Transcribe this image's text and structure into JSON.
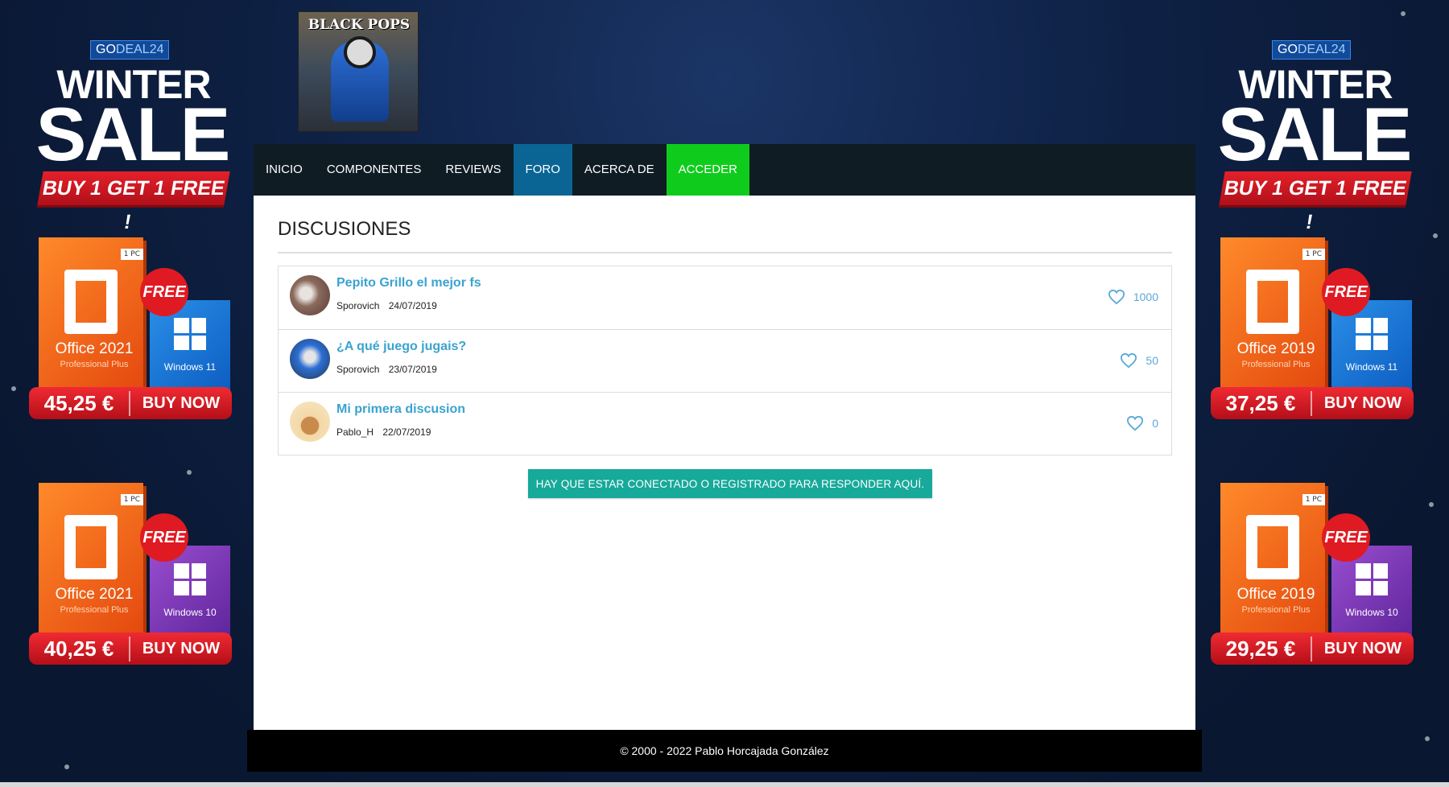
{
  "site": {
    "logo_text": "BLACK POPS"
  },
  "nav": {
    "items": [
      {
        "label": "INICIO"
      },
      {
        "label": "COMPONENTES"
      },
      {
        "label": "REVIEWS"
      },
      {
        "label": "FORO"
      },
      {
        "label": "ACERCA DE"
      },
      {
        "label": "ACCEDER"
      }
    ],
    "active": "FORO",
    "active_color": "#0a6594",
    "accent_color": "#0fcc1c"
  },
  "page": {
    "title": "DISCUSIONES"
  },
  "threads": [
    {
      "title": "Pepito Grillo el mejor fs",
      "author": "Sporovich",
      "date": "24/07/2019",
      "likes": "1000"
    },
    {
      "title": "¿A qué juego jugais?",
      "author": "Sporovich",
      "date": "23/07/2019",
      "likes": "50"
    },
    {
      "title": "Mi primera discusion",
      "author": "Pablo_H",
      "date": "22/07/2019",
      "likes": "0"
    }
  ],
  "reply_button": {
    "label": "HAY QUE ESTAR CONECTADO O REGISTRADO PARA RESPONDER AQUÍ."
  },
  "footer": {
    "text": "© 2000 - 2022 Pablo Horcajada González"
  },
  "ads": {
    "left": {
      "brand_a": "GO",
      "brand_b": "DEAL24",
      "winter": "WINTER",
      "sale": "SALE",
      "promo": "BUY 1 GET 1 FREE !",
      "products": [
        {
          "office": "Office 2021",
          "office_sub": "Professional Plus",
          "windows": "Windows 11",
          "price": "45,25 €",
          "cta": "BUY NOW",
          "free": "FREE",
          "pc": "1 PC"
        },
        {
          "office": "Office 2021",
          "office_sub": "Professional Plus",
          "windows": "Windows 10",
          "price": "40,25 €",
          "cta": "BUY NOW",
          "free": "FREE",
          "pc": "1 PC"
        }
      ]
    },
    "right": {
      "brand_a": "GO",
      "brand_b": "DEAL24",
      "winter": "WINTER",
      "sale": "SALE",
      "promo": "BUY 1 GET 1 FREE !",
      "products": [
        {
          "office": "Office 2019",
          "office_sub": "Professional Plus",
          "windows": "Windows 11",
          "price": "37,25 €",
          "cta": "BUY NOW",
          "free": "FREE",
          "pc": "1 PC"
        },
        {
          "office": "Office 2019",
          "office_sub": "Professional Plus",
          "windows": "Windows 10",
          "price": "29,25 €",
          "cta": "BUY NOW",
          "free": "FREE",
          "pc": "1 PC"
        }
      ]
    }
  },
  "colors": {
    "link": "#3aa3cf",
    "button": "#17a99a",
    "background": "#0b1a35"
  }
}
